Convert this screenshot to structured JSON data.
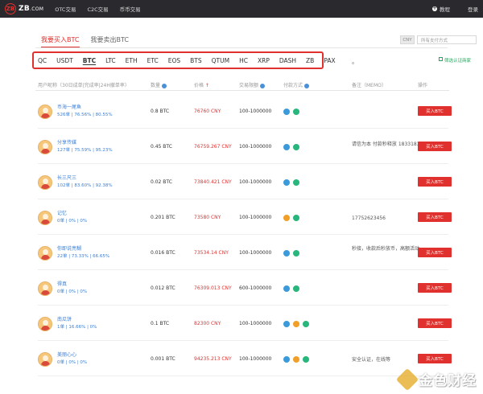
{
  "header": {
    "logo_mark": "ZB",
    "logo_text": "ZB",
    "logo_suffix": ".COM",
    "nav": [
      "OTC交易",
      "C2C交易",
      "币币交易"
    ],
    "help": "教程",
    "login": "登录"
  },
  "tabs": [
    "我要买入BTC",
    "我要卖出BTC"
  ],
  "filters": {
    "currency": "CNY",
    "payment_placeholder": "所有支付方式"
  },
  "coins": [
    "QC",
    "USDT",
    "BTC",
    "LTC",
    "ETH",
    "ETC",
    "EOS",
    "BTS",
    "QTUM",
    "HC",
    "XRP",
    "DASH",
    "ZB",
    "PAX"
  ],
  "active_coin": "BTC",
  "dot": "。",
  "verified_filter": "筛选认证商家",
  "columns": {
    "user": "用户昵称（30日成单|完成率|24H撤单率）",
    "quantity": "数量",
    "price": "价格",
    "limit": "交易限额",
    "payment": "付款方式",
    "memo": "备注（MEMO）",
    "action": "操作"
  },
  "rows": [
    {
      "name": "币海一尾鱼",
      "stats": "526单 | 76.56% | 80.55%",
      "qty": "0.8 BTC",
      "price": "76760 CNY",
      "limit": "100-1000000",
      "pay": [
        "blue",
        "green"
      ],
      "memo": "",
      "btn": "买入BTC"
    },
    {
      "name": "分享传媒",
      "stats": "127单 | 75.59% | 95.23%",
      "qty": "0.45 BTC",
      "price": "76759.267 CNY",
      "limit": "100-1000000",
      "pay": [
        "blue",
        "green"
      ],
      "memo": "请信为本 付款秒释放 18331836011",
      "btn": "买入BTC"
    },
    {
      "name": "长三尺三",
      "stats": "102单 | 83.60% | 92.38%",
      "qty": "0.02 BTC",
      "price": "73840.421 CNY",
      "limit": "100-1000000",
      "pay": [
        "blue",
        "green"
      ],
      "memo": "",
      "btn": "买入BTC"
    },
    {
      "name": "记忆",
      "stats": "0单 | 0% | 0%",
      "qty": "0.201 BTC",
      "price": "73580 CNY",
      "limit": "100-1000000",
      "pay": [
        "orange",
        "green"
      ],
      "memo": "17752623456",
      "btn": "买入BTC"
    },
    {
      "name": "你即说亮糊",
      "stats": "22单 | 73.33% | 66.65%",
      "qty": "0.016 BTC",
      "price": "73534.14 CNY",
      "limit": "100-1000000",
      "pay": [
        "blue",
        "green"
      ],
      "memo": "秒接，收款后秒放币，高额活动",
      "btn": "买入BTC"
    },
    {
      "name": "得真",
      "stats": "0单 | 0% | 0%",
      "qty": "0.012 BTC",
      "price": "76309.013 CNY",
      "limit": "600-1000000",
      "pay": [
        "blue",
        "green"
      ],
      "memo": "",
      "btn": "买入BTC"
    },
    {
      "name": "南瓜饼",
      "stats": "1单 | 16.66% | 0%",
      "qty": "0.1 BTC",
      "price": "82300 CNY",
      "limit": "100-1000000",
      "pay": [
        "blue",
        "orange",
        "green"
      ],
      "memo": "",
      "btn": "买入BTC"
    },
    {
      "name": "美丽心心",
      "stats": "0单 | 0% | 0%",
      "qty": "0.001 BTC",
      "price": "94235.213 CNY",
      "limit": "100-1000000",
      "pay": [
        "blue",
        "orange",
        "green"
      ],
      "memo": "安全认证，在线等",
      "btn": "买入BTC"
    }
  ],
  "watermark": "金色财经",
  "colors": {
    "brand_red": "#e0312e",
    "link_blue": "#3b7fd4",
    "header_bg": "#2a2a2e"
  }
}
